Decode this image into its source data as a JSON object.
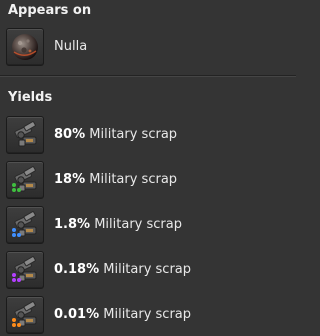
{
  "appears_on": {
    "title": "Appears on",
    "planet": {
      "name": "Nulla",
      "icon": "planet-icon"
    }
  },
  "yields": {
    "title": "Yields",
    "items": [
      {
        "percent": "80%",
        "name": "Military scrap",
        "icon": "military-scrap-icon",
        "quality_color": ""
      },
      {
        "percent": "18%",
        "name": "Military scrap",
        "icon": "military-scrap-icon",
        "quality_color": "#3fbf3f"
      },
      {
        "percent": "1.8%",
        "name": "Military scrap",
        "icon": "military-scrap-icon",
        "quality_color": "#3f8fff"
      },
      {
        "percent": "0.18%",
        "name": "Military scrap",
        "icon": "military-scrap-icon",
        "quality_color": "#b33fff"
      },
      {
        "percent": "0.01%",
        "name": "Military scrap",
        "icon": "military-scrap-icon",
        "quality_color": "#ff8c1a"
      }
    ]
  }
}
